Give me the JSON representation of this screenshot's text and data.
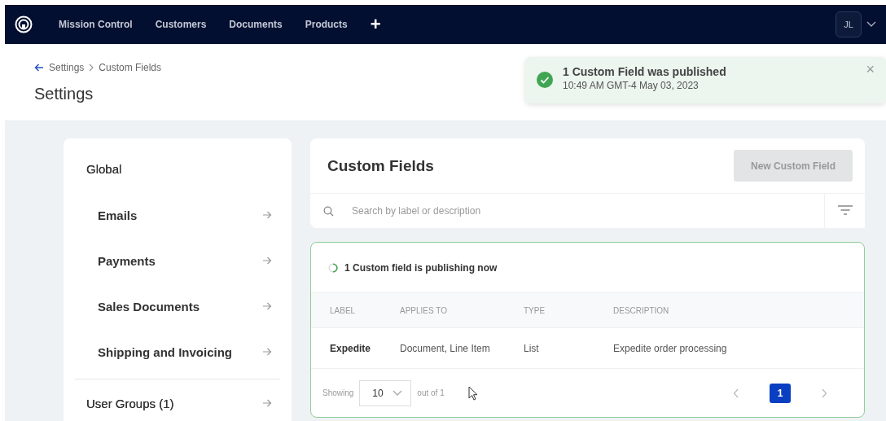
{
  "nav": {
    "items": [
      {
        "label": "Mission Control",
        "selected": false
      },
      {
        "label": "Customers",
        "selected": false
      },
      {
        "label": "Documents",
        "selected": false
      },
      {
        "label": "Products",
        "selected": false
      }
    ],
    "add": "+",
    "user_initials": "JL"
  },
  "breadcrumb": [
    "Settings",
    "Custom Fields"
  ],
  "page_title": "Settings",
  "toast": {
    "title": "1 Custom Field was published",
    "time": "10:49 AM GMT-4 May 03, 2023",
    "close": "×"
  },
  "sidebar": {
    "groups": [
      {
        "label": "Global",
        "kind": "section",
        "children": [
          {
            "label": "Emails"
          },
          {
            "label": "Payments"
          },
          {
            "label": "Sales Documents"
          },
          {
            "label": "Shipping and Invoicing"
          }
        ]
      },
      {
        "label": "User Groups (1)",
        "kind": "link"
      }
    ]
  },
  "card": {
    "title": "Custom Fields",
    "button": {
      "label": "New Custom Field",
      "disabled": true
    }
  },
  "search": {
    "placeholder": "Search by label or description"
  },
  "publishing": {
    "text": "1 Custom field is publishing now"
  },
  "table": {
    "columns": [
      "LABEL",
      "APPLIES TO",
      "TYPE",
      "DESCRIPTION"
    ],
    "rows": [
      [
        "Expedite",
        "Document, Line Item",
        "List",
        "Expedite order processing"
      ]
    ]
  },
  "pagination": {
    "showing": "Showing",
    "page_size": "10",
    "out_of": "out of 1",
    "pages": [
      {
        "label": "1",
        "selected": true
      }
    ]
  }
}
